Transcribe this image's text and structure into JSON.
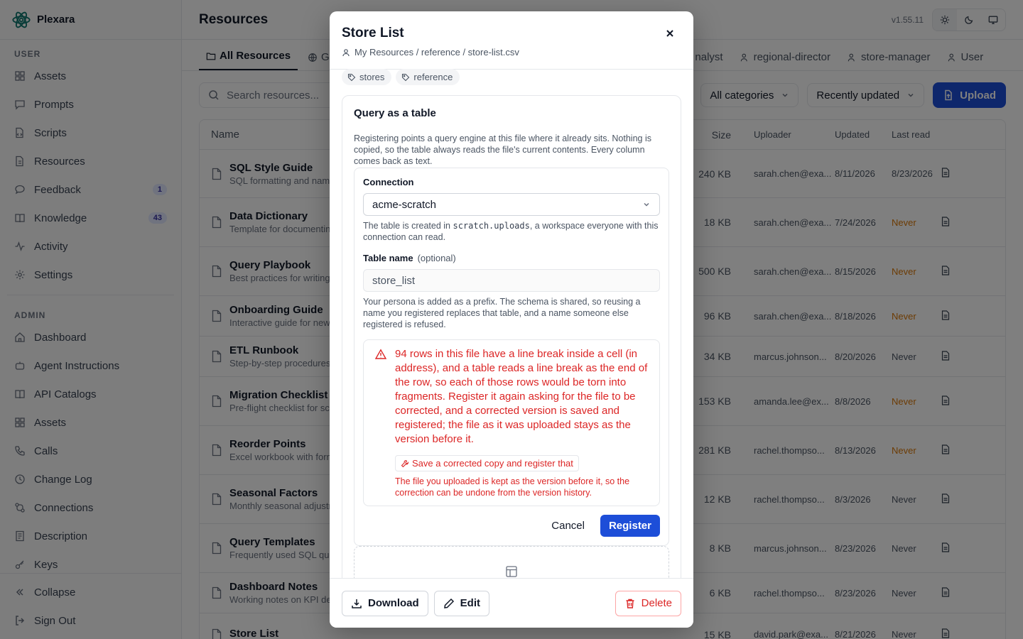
{
  "app": {
    "name": "Plexara",
    "version": "v1.55.11"
  },
  "sidebar": {
    "user_label": "USER",
    "user_items": [
      {
        "label": "Assets",
        "icon": "grid-icon"
      },
      {
        "label": "Prompts",
        "icon": "message-icon"
      },
      {
        "label": "Scripts",
        "icon": "code-icon"
      },
      {
        "label": "Resources",
        "icon": "file-icon"
      },
      {
        "label": "Feedback",
        "icon": "chat-icon",
        "badge": "1"
      },
      {
        "label": "Knowledge",
        "icon": "book-icon",
        "badge": "43"
      },
      {
        "label": "Activity",
        "icon": "activity-icon"
      },
      {
        "label": "Settings",
        "icon": "gear-icon"
      }
    ],
    "admin_label": "ADMIN",
    "admin_items": [
      {
        "label": "Dashboard",
        "icon": "home-icon"
      },
      {
        "label": "Agent Instructions",
        "icon": "bot-icon"
      },
      {
        "label": "API Catalogs",
        "icon": "book-icon"
      },
      {
        "label": "Assets",
        "icon": "grid-icon"
      },
      {
        "label": "Calls",
        "icon": "phone-icon"
      },
      {
        "label": "Change Log",
        "icon": "clock-icon"
      },
      {
        "label": "Connections",
        "icon": "link-icon"
      },
      {
        "label": "Description",
        "icon": "doc-icon"
      },
      {
        "label": "Keys",
        "icon": "key-icon"
      }
    ],
    "collapse": "Collapse",
    "sign_out": "Sign Out"
  },
  "page": {
    "title": "Resources",
    "tabs": [
      {
        "label": "All Resources",
        "active": true
      },
      {
        "label": "Glo"
      },
      {
        "label": "nalyst"
      },
      {
        "label": "regional-director"
      },
      {
        "label": "store-manager"
      },
      {
        "label": "User"
      }
    ],
    "search_placeholder": "Search resources...",
    "category_select": "All categories",
    "sort_select": "Recently updated",
    "upload_label": "Upload",
    "columns": {
      "name": "Name",
      "size": "Size",
      "uploader": "Uploader",
      "updated": "Updated",
      "last_read": "Last read"
    },
    "rows": [
      {
        "title": "SQL Style Guide",
        "desc": "SQL formatting and naming",
        "size": "240 KB",
        "uploader": "sarah.chen@exa...",
        "updated": "8/11/2026",
        "last_read": "8/23/2026"
      },
      {
        "title": "Data Dictionary",
        "desc": "Template for documenting",
        "size": "18 KB",
        "uploader": "sarah.chen@exa...",
        "updated": "7/24/2026",
        "last_read": "Never",
        "never_highlight": true
      },
      {
        "title": "Query Playbook",
        "desc": "Best practices for writing",
        "size": "500 KB",
        "uploader": "sarah.chen@exa...",
        "updated": "8/15/2026",
        "last_read": "Never",
        "never_highlight": true
      },
      {
        "title": "Onboarding Guide",
        "desc": "Interactive guide for new",
        "size": "96 KB",
        "uploader": "sarah.chen@exa...",
        "updated": "8/18/2026",
        "last_read": "Never",
        "never_highlight": true
      },
      {
        "title": "ETL Runbook",
        "desc": "Step-by-step procedures",
        "size": "34 KB",
        "uploader": "marcus.johnson...",
        "updated": "8/20/2026",
        "last_read": "Never"
      },
      {
        "title": "Migration Checklist",
        "desc": "Pre-flight checklist for sc",
        "size": "153 KB",
        "uploader": "amanda.lee@ex...",
        "updated": "8/8/2026",
        "last_read": "Never",
        "never_highlight": true
      },
      {
        "title": "Reorder Points",
        "desc": "Excel workbook with form",
        "size": "281 KB",
        "uploader": "rachel.thompso...",
        "updated": "8/13/2026",
        "last_read": "Never",
        "never_highlight": true
      },
      {
        "title": "Seasonal Factors",
        "desc": "Monthly seasonal adjustm",
        "size": "12 KB",
        "uploader": "rachel.thompso...",
        "updated": "8/3/2026",
        "last_read": "Never"
      },
      {
        "title": "Query Templates",
        "desc": "Frequently used SQL que",
        "size": "8 KB",
        "uploader": "marcus.johnson...",
        "updated": "8/23/2026",
        "last_read": "Never"
      },
      {
        "title": "Dashboard Notes",
        "desc": "Working notes on KPI def",
        "size": "6 KB",
        "uploader": "rachel.thompso...",
        "updated": "8/23/2026",
        "last_read": "Never"
      },
      {
        "title": "Store List",
        "desc": "",
        "size": "15 KB",
        "uploader": "david.park@exa...",
        "updated": "8/21/2026",
        "last_read": "Never"
      }
    ]
  },
  "modal": {
    "title": "Store List",
    "path": "My Resources / reference / store-list.csv",
    "tags": [
      "stores",
      "reference"
    ],
    "card_title": "Query as a table",
    "card_desc": "Registering points a query engine at this file where it already sits. Nothing is copied, so the table always reads the file's current contents. Every column comes back as text.",
    "connection_label": "Connection",
    "connection_value": "acme-scratch",
    "connection_help_pre": "The table is created in ",
    "connection_help_code": "scratch.uploads",
    "connection_help_post": ", a workspace everyone with this connection can read.",
    "table_name_label": "Table name",
    "table_name_optional": "(optional)",
    "table_name_value": "store_list",
    "table_name_help": "Your persona is added as a prefix. The schema is shared, so reusing a name you registered replaces that table, and a name someone else registered is refused.",
    "alert_message": "94 rows in this file have a line break inside a cell (in address), and a table reads a line break as the end of the row, so each of those rows would be torn into fragments. Register it again asking for the file to be corrected, and a corrected version is saved and registered; the file as it was uploaded stays as the version before it.",
    "fix_button": "Save a corrected copy and register that",
    "alert_note": "The file you uploaded is kept as the version before it, so the correction can be undone from the version history.",
    "cancel_label": "Cancel",
    "register_label": "Register",
    "download_label": "Download",
    "edit_label": "Edit",
    "delete_label": "Delete"
  },
  "colors": {
    "accent": "#1d4ed8",
    "danger": "#dc2626",
    "warning": "#d97706"
  }
}
